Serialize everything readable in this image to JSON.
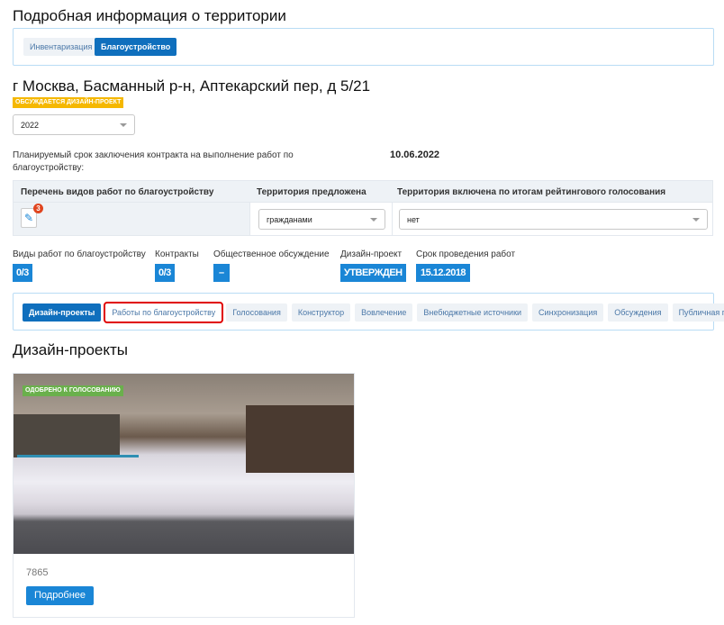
{
  "page_title": "Подробная информация о территории",
  "top_tabs": [
    {
      "label": "Инвентаризация",
      "active": false
    },
    {
      "label": "Благоустройство",
      "active": true
    }
  ],
  "address": "г Москва, Басманный р-н, Аптекарский пер, д 5/21",
  "status_badge": "ОБСУЖДАЕТСЯ ДИЗАЙН-ПРОЕКТ",
  "year_select": "2022",
  "contract_label": "Планируемый срок заключения контракта на выполнение работ по благоустройству:",
  "contract_date": "10.06.2022",
  "table": {
    "headers": [
      "Перечень видов работ по благоустройству",
      "Территория предложена",
      "Территория включена по итогам рейтингового голосования"
    ],
    "works_count": "3",
    "proposed_by": "гражданами",
    "included": "нет"
  },
  "stats": [
    {
      "label": "Виды работ по благоустройству",
      "value": "0/3"
    },
    {
      "label": "Контракты",
      "value": "0/3"
    },
    {
      "label": "Общественное обсуждение",
      "value": "–"
    },
    {
      "label": "Дизайн-проект",
      "value": "УТВЕРЖДЕН"
    },
    {
      "label": "Срок проведения работ",
      "value": "15.12.2018"
    }
  ],
  "section_tabs": [
    {
      "label": "Дизайн-проекты"
    },
    {
      "label": "Работы по благоустройству"
    },
    {
      "label": "Голосования"
    },
    {
      "label": "Конструктор"
    },
    {
      "label": "Вовлечение"
    },
    {
      "label": "Внебюджетные источники"
    },
    {
      "label": "Синхронизация"
    },
    {
      "label": "Обсуждения"
    },
    {
      "label": "Публичная приемка"
    }
  ],
  "design_heading": "Дизайн-проекты",
  "card": {
    "badge": "ОДОБРЕНО К ГОЛОСОВАНИЮ",
    "id": "7865",
    "button": "Подробнее"
  },
  "colors": {
    "accent": "#0f6fbd",
    "badge_blue": "#1a86d6",
    "status_yellow": "#f5b800",
    "approved_green": "#6ab04c",
    "highlight_red": "#e00000"
  }
}
